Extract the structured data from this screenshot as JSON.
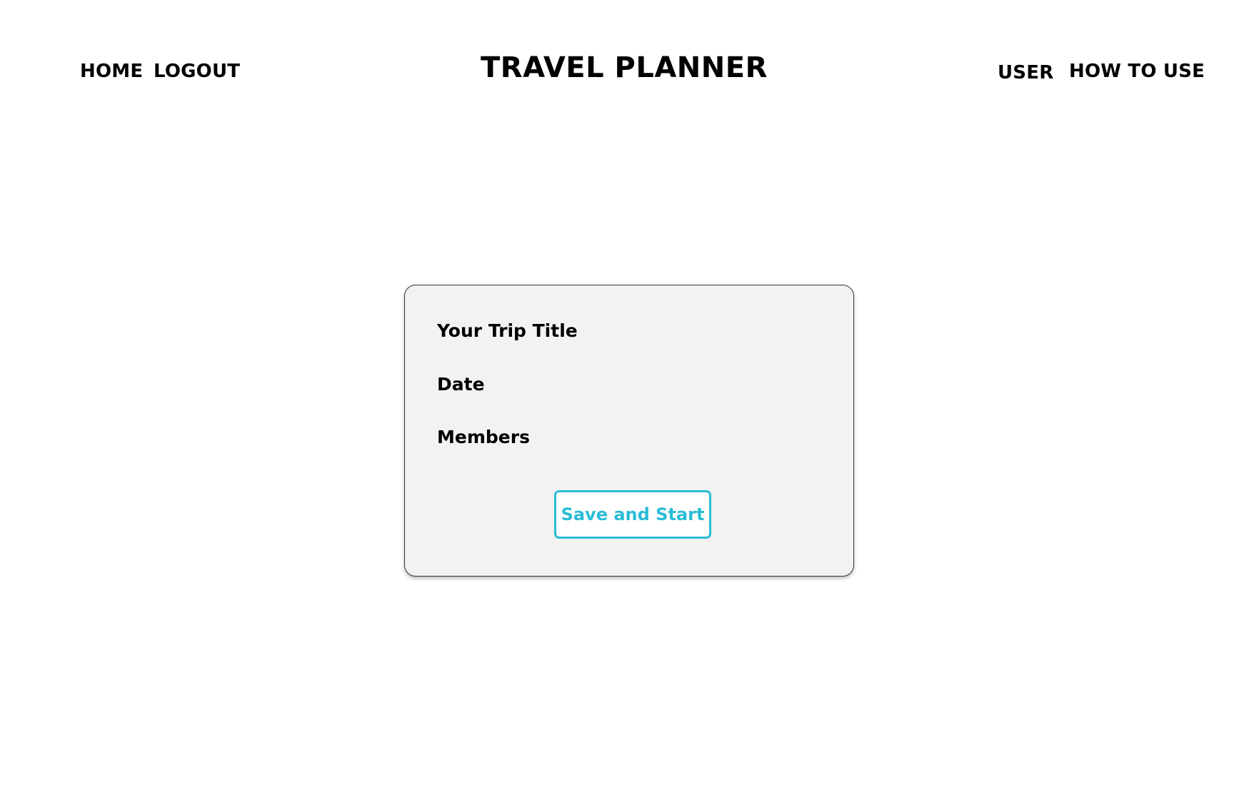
{
  "header": {
    "title": "TRAVEL PLANNER",
    "nav_left": {
      "home_label": "HOME",
      "logout_label": "LOGOUT"
    },
    "nav_right": {
      "user_label": "USER",
      "how_to_use_label": "HOW TO USE"
    }
  },
  "trip_form": {
    "title_label": "Your Trip Title",
    "date_label": "Date",
    "members_label": "Members",
    "save_button_label": "Save and Start"
  },
  "colors": {
    "accent": "#29bcd6",
    "card_background": "#f2f2f2",
    "text": "#000000",
    "page_background": "#ffffff"
  }
}
